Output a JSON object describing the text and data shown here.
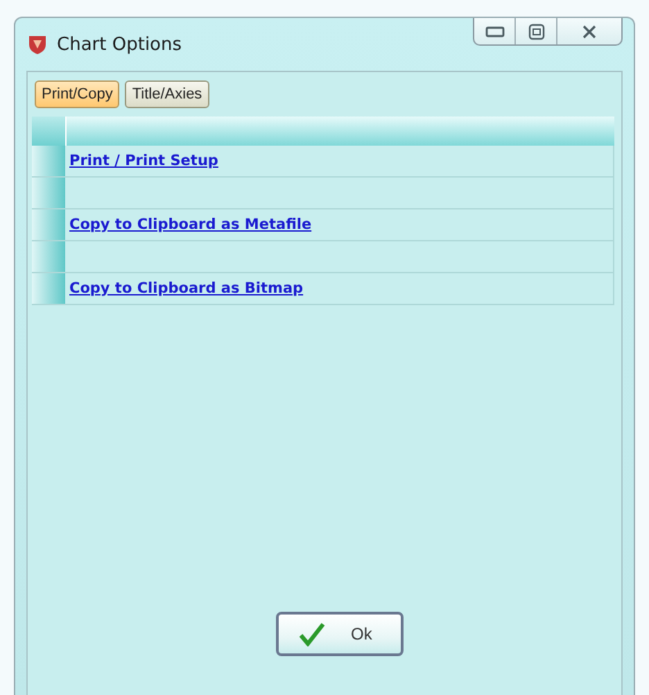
{
  "window": {
    "title": "Chart Options"
  },
  "tabs": [
    {
      "label": "Print/Copy",
      "selected": true
    },
    {
      "label": "Title/Axies",
      "selected": false
    }
  ],
  "grid_rows": [
    {
      "kind": "link",
      "text": "Print / Print Setup"
    },
    {
      "kind": "blank"
    },
    {
      "kind": "link",
      "text": "Copy to Clipboard as Metafile"
    },
    {
      "kind": "blank"
    },
    {
      "kind": "link",
      "text": "Copy to Clipboard as Bitmap"
    }
  ],
  "ok_button": {
    "label": "Ok"
  }
}
